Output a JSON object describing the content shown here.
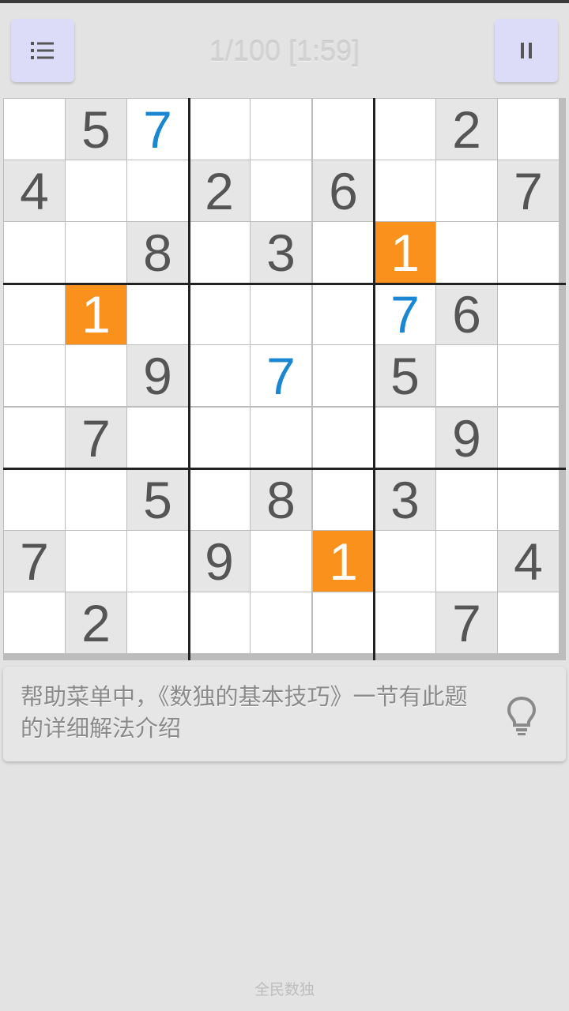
{
  "header": {
    "menu_icon": "list-icon",
    "progress": "1/100 [1:59]",
    "pause_icon": "pause-icon"
  },
  "board": {
    "rows": [
      [
        {
          "v": ""
        },
        {
          "v": "5",
          "t": "given"
        },
        {
          "v": "7",
          "t": "user"
        },
        {
          "v": ""
        },
        {
          "v": ""
        },
        {
          "v": ""
        },
        {
          "v": ""
        },
        {
          "v": "2",
          "t": "given"
        },
        {
          "v": ""
        }
      ],
      [
        {
          "v": "4",
          "t": "given"
        },
        {
          "v": ""
        },
        {
          "v": ""
        },
        {
          "v": "2",
          "t": "given"
        },
        {
          "v": ""
        },
        {
          "v": "6",
          "t": "given"
        },
        {
          "v": ""
        },
        {
          "v": ""
        },
        {
          "v": "7",
          "t": "given"
        }
      ],
      [
        {
          "v": ""
        },
        {
          "v": ""
        },
        {
          "v": "8",
          "t": "given"
        },
        {
          "v": ""
        },
        {
          "v": "3",
          "t": "given"
        },
        {
          "v": ""
        },
        {
          "v": "1",
          "t": "hl"
        },
        {
          "v": ""
        },
        {
          "v": ""
        }
      ],
      [
        {
          "v": ""
        },
        {
          "v": "1",
          "t": "hl"
        },
        {
          "v": ""
        },
        {
          "v": ""
        },
        {
          "v": ""
        },
        {
          "v": ""
        },
        {
          "v": "7",
          "t": "user"
        },
        {
          "v": "6",
          "t": "given"
        },
        {
          "v": ""
        }
      ],
      [
        {
          "v": ""
        },
        {
          "v": ""
        },
        {
          "v": "9",
          "t": "given"
        },
        {
          "v": ""
        },
        {
          "v": "7",
          "t": "user"
        },
        {
          "v": ""
        },
        {
          "v": "5",
          "t": "given"
        },
        {
          "v": ""
        },
        {
          "v": ""
        }
      ],
      [
        {
          "v": ""
        },
        {
          "v": "7",
          "t": "given"
        },
        {
          "v": ""
        },
        {
          "v": ""
        },
        {
          "v": ""
        },
        {
          "v": ""
        },
        {
          "v": ""
        },
        {
          "v": "9",
          "t": "given"
        },
        {
          "v": ""
        }
      ],
      [
        {
          "v": ""
        },
        {
          "v": ""
        },
        {
          "v": "5",
          "t": "given"
        },
        {
          "v": ""
        },
        {
          "v": "8",
          "t": "given"
        },
        {
          "v": ""
        },
        {
          "v": "3",
          "t": "given"
        },
        {
          "v": ""
        },
        {
          "v": ""
        }
      ],
      [
        {
          "v": "7",
          "t": "given"
        },
        {
          "v": ""
        },
        {
          "v": ""
        },
        {
          "v": "9",
          "t": "given"
        },
        {
          "v": ""
        },
        {
          "v": "1",
          "t": "hl"
        },
        {
          "v": ""
        },
        {
          "v": ""
        },
        {
          "v": "4",
          "t": "given"
        }
      ],
      [
        {
          "v": ""
        },
        {
          "v": "2",
          "t": "given"
        },
        {
          "v": ""
        },
        {
          "v": ""
        },
        {
          "v": ""
        },
        {
          "v": ""
        },
        {
          "v": ""
        },
        {
          "v": "7",
          "t": "given"
        },
        {
          "v": ""
        }
      ]
    ]
  },
  "colors": {
    "given_text": "#555555",
    "user_text": "#1a87d2",
    "highlight_bg": "#fa911c",
    "given_bg": "#e6e6e6",
    "empty_bg": "#ffffff"
  },
  "hint": {
    "text": "帮助菜单中，《数独的基本技巧》一节有此题的详细解法介绍",
    "icon": "lightbulb-icon"
  },
  "footer": {
    "app_name": "全民数独"
  }
}
